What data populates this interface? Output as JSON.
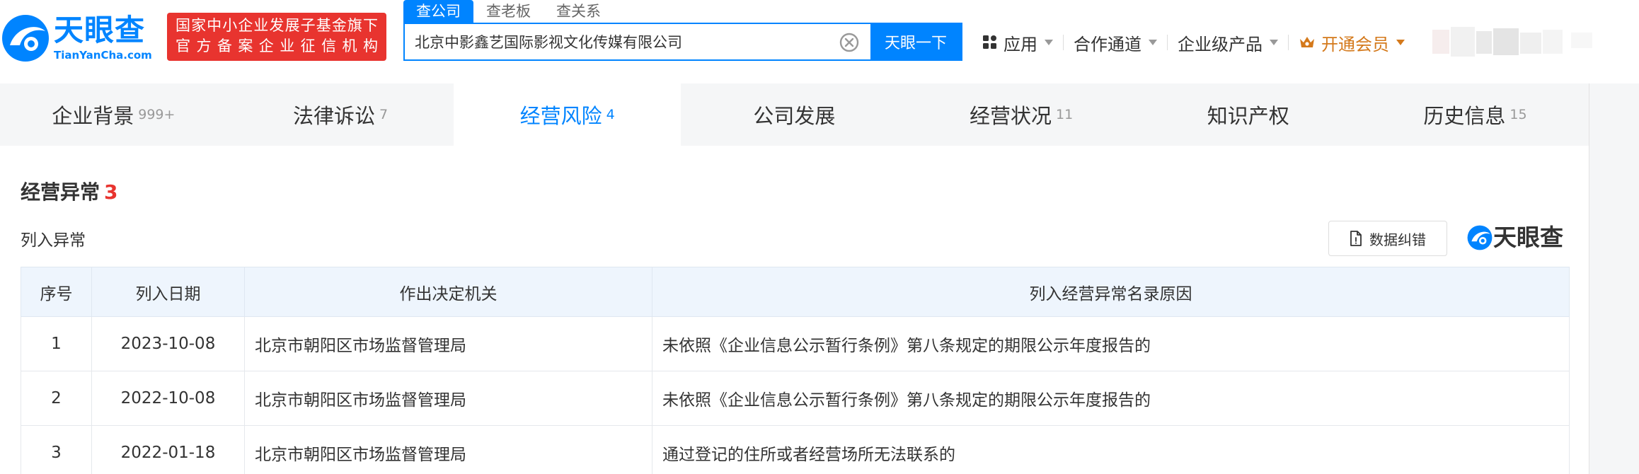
{
  "header": {
    "logo_name": "天眼查",
    "logo_domain": "TianYanCha.com",
    "badge_line1": "国家中小企业发展子基金旗下",
    "badge_line2": "官方备案企业征信机构",
    "search_tabs": [
      "查公司",
      "查老板",
      "查关系"
    ],
    "search_value": "北京中影鑫艺国际影视文化传媒有限公司",
    "search_button": "天眼一下",
    "nav": {
      "apps": "应用",
      "channels": "合作通道",
      "enterprise": "企业级产品",
      "vip": "开通会员"
    }
  },
  "tabs": [
    {
      "label": "企业背景",
      "count": "999+"
    },
    {
      "label": "法律诉讼",
      "count": "7"
    },
    {
      "label": "经营风险",
      "count": "4"
    },
    {
      "label": "公司发展",
      "count": ""
    },
    {
      "label": "经营状况",
      "count": "11"
    },
    {
      "label": "知识产权",
      "count": ""
    },
    {
      "label": "历史信息",
      "count": "15"
    }
  ],
  "active_tab": "经营风险",
  "section": {
    "title": "经营异常",
    "count": "3",
    "subsection": "列入异常",
    "report_button": "数据纠错",
    "watermark": "天眼查"
  },
  "table": {
    "headers": [
      "序号",
      "列入日期",
      "作出决定机关",
      "列入经营异常名录原因"
    ],
    "rows": [
      {
        "index": "1",
        "date": "2023-10-08",
        "authority": "北京市朝阳区市场监督管理局",
        "reason": "未依照《企业信息公示暂行条例》第八条规定的期限公示年度报告的"
      },
      {
        "index": "2",
        "date": "2022-10-08",
        "authority": "北京市朝阳区市场监督管理局",
        "reason": "未依照《企业信息公示暂行条例》第八条规定的期限公示年度报告的"
      },
      {
        "index": "3",
        "date": "2022-01-18",
        "authority": "北京市朝阳区市场监督管理局",
        "reason": "通过登记的住所或者经营场所无法联系的"
      }
    ]
  },
  "icons": {
    "logo": "tianyancha-eye-logo-icon",
    "clear": "clear-circle-icon",
    "apps": "apps-grid-icon",
    "vip": "crown-icon",
    "report": "document-icon",
    "avatar": "user-avatar-icon"
  },
  "colors": {
    "brand": "#0084ff",
    "badge": "#e8342f",
    "vip": "#d4791b",
    "count_red": "#e8342f",
    "tab_bar": "#f5f6f7",
    "table_header": "#eef5fd"
  }
}
